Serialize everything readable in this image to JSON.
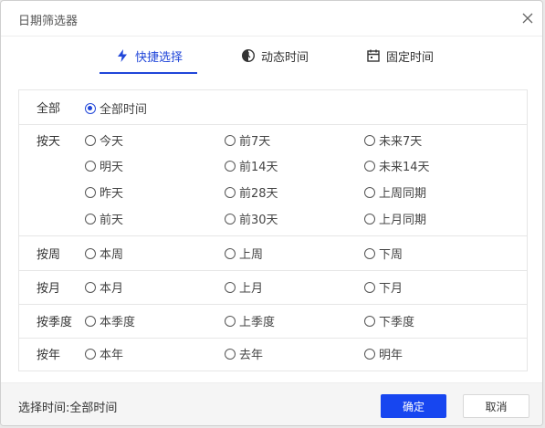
{
  "dialog": {
    "title": "日期筛选器"
  },
  "tabs": [
    {
      "label": "快捷选择",
      "icon": "lightning-icon",
      "active": true
    },
    {
      "label": "动态时间",
      "icon": "dynamic-clock-icon",
      "active": false
    },
    {
      "label": "固定时间",
      "icon": "calendar-icon",
      "active": false
    }
  ],
  "groups": [
    {
      "label": "全部",
      "options": [
        "全部时间"
      ]
    },
    {
      "label": "按天",
      "options": [
        "今天",
        "前7天",
        "未来7天",
        "明天",
        "前14天",
        "未来14天",
        "昨天",
        "前28天",
        "上周同期",
        "前天",
        "前30天",
        "上月同期"
      ]
    },
    {
      "label": "按周",
      "options": [
        "本周",
        "上周",
        "下周"
      ]
    },
    {
      "label": "按月",
      "options": [
        "本月",
        "上月",
        "下月"
      ]
    },
    {
      "label": "按季度",
      "options": [
        "本季度",
        "上季度",
        "下季度"
      ]
    },
    {
      "label": "按年",
      "options": [
        "本年",
        "去年",
        "明年"
      ]
    }
  ],
  "selected_option": "全部时间",
  "footer": {
    "selected_label": "选择时间:",
    "selected_value": "全部时间",
    "ok_label": "确定",
    "cancel_label": "取消"
  },
  "colors": {
    "accent": "#2046d9",
    "primary_button": "#1746f0"
  }
}
